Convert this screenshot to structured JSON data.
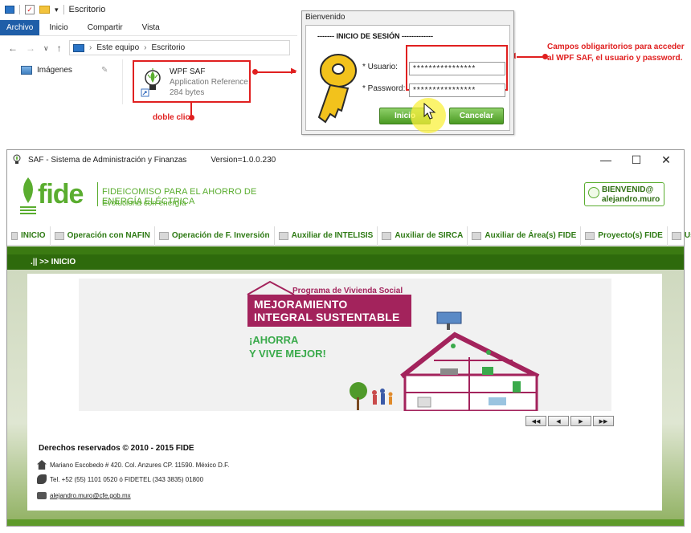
{
  "explorer": {
    "path_title": "Escritorio",
    "ribbon": {
      "file_tab": "Archivo",
      "tabs": [
        "Inicio",
        "Compartir",
        "Vista"
      ]
    },
    "address": {
      "segment1": "Este equipo",
      "segment2": "Escritorio",
      "separator": "›"
    },
    "nav": {
      "back": "←",
      "forward": "→",
      "dropdown": "∨",
      "up": "↑"
    },
    "sidebar_item": "Imágenes",
    "file": {
      "name": "WPF SAF",
      "type": "Application Reference",
      "size": "284 bytes"
    },
    "double_click_note": "doble clic"
  },
  "login": {
    "window_title": "Bienvenido",
    "heading": "------- INICIO DE SESIÓN -------------",
    "user_label": "* Usuario:",
    "password_label": "* Password:",
    "user_value": "****************",
    "password_value": "****************",
    "inicio_button": "Inicio",
    "cancel_button": "Cancelar"
  },
  "annotation": "Campos obligaritorios para acceder al WPF SAF, el usuario y password.",
  "app": {
    "title": "SAF - Sistema de Administración y Finanzas",
    "version": "Version=1.0.0.230",
    "controls": {
      "minimize": "—",
      "maximize": "☐",
      "close": "✕"
    },
    "logo": {
      "word": "fide",
      "line1": "FIDEICOMISO PARA EL AHORRO DE ENERGÍA ELÉCTRICA",
      "line2": "Evoluciona con energía"
    },
    "welcome": {
      "line1": "BIENVENID@",
      "line2": "alejandro.muro"
    },
    "menu": [
      "INICIO",
      "Operación con NAFIN",
      "Operación de F. Inversión",
      "Auxiliar de INTELISIS",
      "Auxiliar de SIRCA",
      "Auxiliar de Área(s) FIDE",
      "Proyecto(s) FIDE",
      "Usuario(s)"
    ],
    "breadcrumb": ".|| >> INICIO",
    "banner": {
      "program": "Programa de Vivienda Social",
      "title_line1": "MEJORAMIENTO",
      "title_line2": "INTEGRAL SUSTENTABLE",
      "slogan_line1": "¡AHORRA",
      "slogan_line2": "Y VIVE MEJOR!"
    },
    "pager": [
      "◀◀",
      "◀",
      "▶",
      "▶▶"
    ],
    "footer": {
      "rights": "Derechos reservados © 2010 - 2015 FIDE",
      "address": "Mariano Escobedo # 420. Col. Anzures CP. 11590. México D.F.",
      "phone": "Tel. +52 (55) 1101 0520 ó FIDETEL (343 3835) 01800",
      "email": "alejandro.muro@cfe.gob.mx"
    }
  },
  "colors": {
    "fide_green": "#5aad2f",
    "dark_green": "#2e6a0c",
    "annotation_red": "#e02020",
    "banner_magenta": "#a3235c"
  }
}
